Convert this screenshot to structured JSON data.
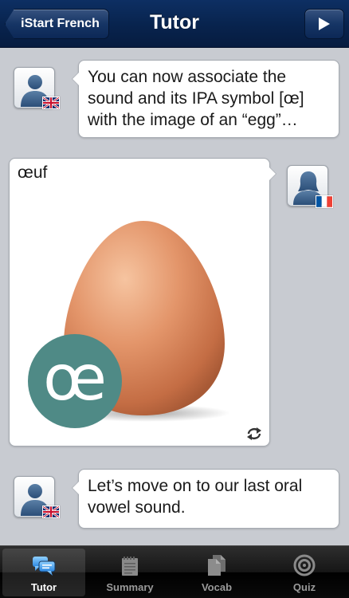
{
  "navbar": {
    "back_label": "iStart French",
    "title": "Tutor",
    "play_icon": "play-icon"
  },
  "messages": [
    {
      "speaker": "tutor",
      "flag": "uk-flag",
      "lines": [
        "You can now associate the",
        "sound and its IPA symbol [œ]",
        "with the image of an “egg”…"
      ]
    },
    {
      "speaker": "french-speaker",
      "flag": "france-flag",
      "card_word": "œuf",
      "ipa_badge": "œ",
      "replay_icon": "repeat-icon"
    },
    {
      "speaker": "tutor",
      "flag": "uk-flag",
      "lines": [
        "Let’s move on to our last oral",
        "vowel sound."
      ]
    }
  ],
  "tabs": [
    {
      "label": "Tutor",
      "icon": "chat-bubbles-icon",
      "active": true
    },
    {
      "label": "Summary",
      "icon": "notepad-icon",
      "active": false
    },
    {
      "label": "Vocab",
      "icon": "documents-icon",
      "active": false
    },
    {
      "label": "Quiz",
      "icon": "target-icon",
      "active": false
    }
  ],
  "colors": {
    "navbar": "#08234d",
    "ipa_badge": "#4f8a86",
    "tab_active": "#3a93e8"
  }
}
